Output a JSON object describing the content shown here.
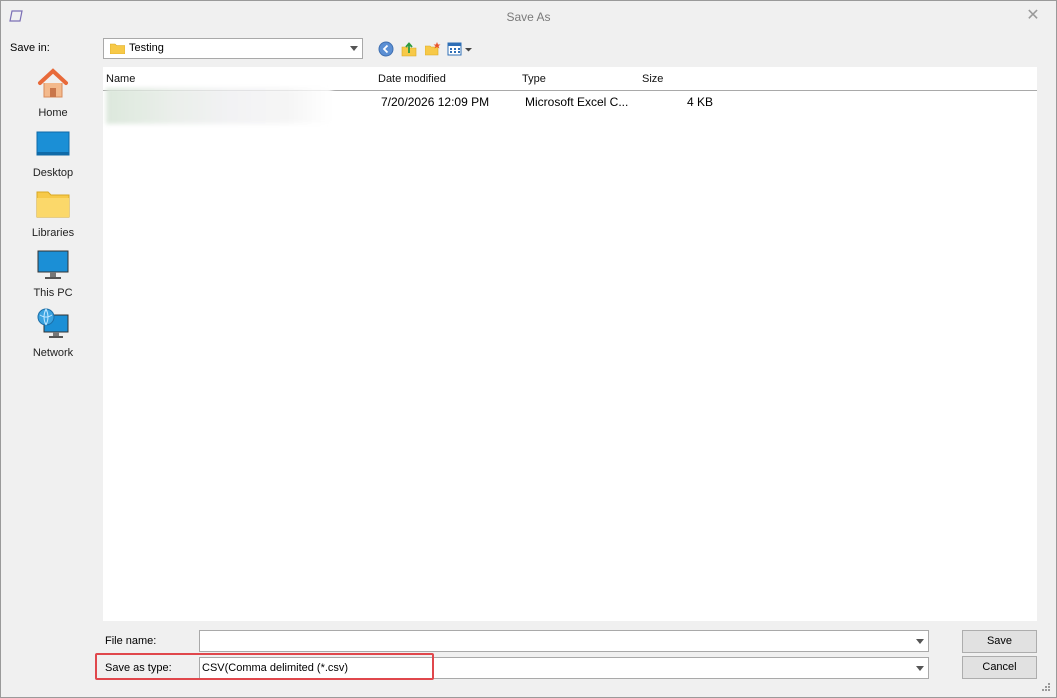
{
  "window": {
    "title": "Save As"
  },
  "toolbar": {
    "save_in_label": "Save in:",
    "current_folder": "Testing"
  },
  "sidebar": {
    "items": [
      {
        "label": "Home",
        "icon": "home-icon"
      },
      {
        "label": "Desktop",
        "icon": "desktop-icon"
      },
      {
        "label": "Libraries",
        "icon": "folder-icon"
      },
      {
        "label": "This PC",
        "icon": "monitor-icon"
      },
      {
        "label": "Network",
        "icon": "network-icon"
      }
    ]
  },
  "filelist": {
    "columns": [
      "Name",
      "Date modified",
      "Type",
      "Size"
    ],
    "rows": [
      {
        "name": "",
        "date": "7/20/2026 12:09 PM",
        "type": "Microsoft Excel C...",
        "size": "4 KB"
      }
    ]
  },
  "form": {
    "file_name_label": "File name:",
    "file_name_value": "",
    "save_as_type_label": "Save as type:",
    "save_as_type_value": "CSV(Comma delimited (*.csv)"
  },
  "buttons": {
    "save": "Save",
    "cancel": "Cancel"
  },
  "colors": {
    "highlight": "#e0474c",
    "folder": "#f7c948",
    "accent": "#1b8fd6"
  }
}
